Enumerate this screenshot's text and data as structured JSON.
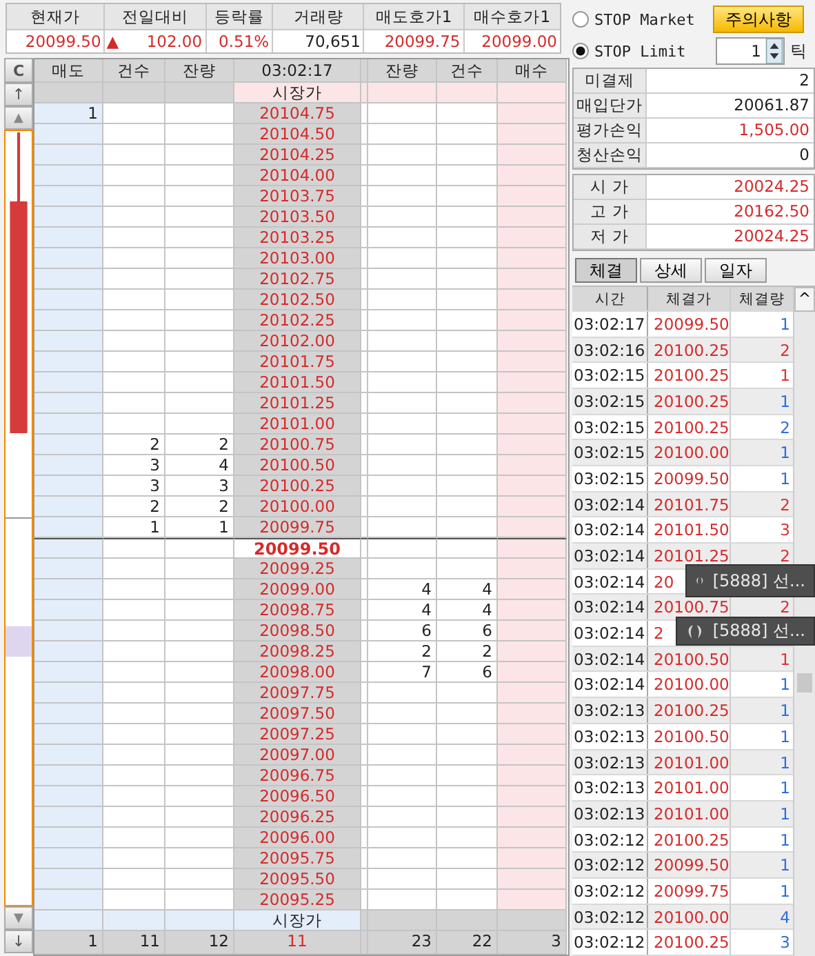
{
  "quotes": [
    {
      "label": "현재가",
      "value": "20099.50",
      "kind": "price"
    },
    {
      "label": "전일대비",
      "arrow": "▲",
      "value": "102.00",
      "kind": "change"
    },
    {
      "label": "등락률",
      "value": "0.51%",
      "kind": "price"
    },
    {
      "label": "거래량",
      "value": "70,651",
      "kind": "volume"
    },
    {
      "label": "매도호가1",
      "value": "20099.75",
      "kind": "price"
    },
    {
      "label": "매수호가1",
      "value": "20099.00",
      "kind": "price"
    }
  ],
  "ladder": {
    "side_buttons": [
      "C",
      "↑",
      "▲",
      "▼",
      "↓"
    ],
    "columns": [
      "매도",
      "건수",
      "잔량",
      "03:02:17",
      "잔량",
      "건수",
      "매수"
    ],
    "market_top": "시장가",
    "market_bottom": "시장가",
    "rows": [
      {
        "price": "20104.75",
        "current": false,
        "ask": "1"
      },
      {
        "price": "20104.50",
        "current": false
      },
      {
        "price": "20104.25",
        "current": false
      },
      {
        "price": "20104.00",
        "current": false
      },
      {
        "price": "20103.75",
        "current": false
      },
      {
        "price": "20103.50",
        "current": false
      },
      {
        "price": "20103.25",
        "current": false
      },
      {
        "price": "20103.00",
        "current": false
      },
      {
        "price": "20102.75",
        "current": false
      },
      {
        "price": "20102.50",
        "current": false
      },
      {
        "price": "20102.25",
        "current": false
      },
      {
        "price": "20102.00",
        "current": false
      },
      {
        "price": "20101.75",
        "current": false
      },
      {
        "price": "20101.50",
        "current": false
      },
      {
        "price": "20101.25",
        "current": false
      },
      {
        "price": "20101.00",
        "current": false
      },
      {
        "price": "20100.75",
        "current": false,
        "ask_count": "2",
        "ask_qty": "2"
      },
      {
        "price": "20100.50",
        "current": false,
        "ask_count": "3",
        "ask_qty": "4"
      },
      {
        "price": "20100.25",
        "current": false,
        "ask_count": "3",
        "ask_qty": "3"
      },
      {
        "price": "20100.00",
        "current": false,
        "ask_count": "2",
        "ask_qty": "2"
      },
      {
        "price": "20099.75",
        "current": false,
        "ask_count": "1",
        "ask_qty": "1"
      },
      {
        "price": "20099.50",
        "current": true
      },
      {
        "price": "20099.25",
        "current": false
      },
      {
        "price": "20099.00",
        "current": false,
        "bid_qty": "4",
        "bid_count": "4"
      },
      {
        "price": "20098.75",
        "current": false,
        "bid_qty": "4",
        "bid_count": "4"
      },
      {
        "price": "20098.50",
        "current": false,
        "bid_qty": "6",
        "bid_count": "6"
      },
      {
        "price": "20098.25",
        "current": false,
        "bid_qty": "2",
        "bid_count": "2"
      },
      {
        "price": "20098.00",
        "current": false,
        "bid_qty": "7",
        "bid_count": "6"
      },
      {
        "price": "20097.75",
        "current": false
      },
      {
        "price": "20097.50",
        "current": false
      },
      {
        "price": "20097.25",
        "current": false
      },
      {
        "price": "20097.00",
        "current": false
      },
      {
        "price": "20096.75",
        "current": false
      },
      {
        "price": "20096.50",
        "current": false
      },
      {
        "price": "20096.25",
        "current": false
      },
      {
        "price": "20096.00",
        "current": false
      },
      {
        "price": "20095.75",
        "current": false
      },
      {
        "price": "20095.50",
        "current": false
      },
      {
        "price": "20095.25",
        "current": false
      }
    ],
    "totals": [
      "1",
      "11",
      "12",
      "11",
      "23",
      "22",
      "3"
    ]
  },
  "stop_options": [
    {
      "label": "STOP Market",
      "selected": false
    },
    {
      "label": "STOP Limit",
      "selected": true
    }
  ],
  "notice_button": "주의사항",
  "tick_input": {
    "value": "1",
    "unit": "틱"
  },
  "position": [
    {
      "label": "미결제",
      "value": "2",
      "kind": "plain"
    },
    {
      "label": "매입단가",
      "value": "20061.87",
      "kind": "plain"
    },
    {
      "label": "평가손익",
      "value": "1,505.00",
      "kind": "profit"
    },
    {
      "label": "청산손익",
      "value": "0",
      "kind": "plain"
    }
  ],
  "day_prices": [
    {
      "label": "시 가",
      "value": "20024.25"
    },
    {
      "label": "고 가",
      "value": "20162.50"
    },
    {
      "label": "저 가",
      "value": "20024.25"
    }
  ],
  "tabs": [
    {
      "label": "체결",
      "selected": true
    },
    {
      "label": "상세",
      "selected": false
    },
    {
      "label": "일자",
      "selected": false
    }
  ],
  "trades": {
    "columns": [
      "시간",
      "체결가",
      "체결량"
    ],
    "scroll_up": "^",
    "rows": [
      {
        "time": "03:02:17",
        "price": "20099.50",
        "qty": "1",
        "color": "#2a6fdb"
      },
      {
        "time": "03:02:16",
        "price": "20100.25",
        "qty": "2",
        "color": "#e03030"
      },
      {
        "time": "03:02:15",
        "price": "20100.25",
        "qty": "1",
        "color": "#e03030"
      },
      {
        "time": "03:02:15",
        "price": "20100.25",
        "qty": "1",
        "color": "#2a6fdb"
      },
      {
        "time": "03:02:15",
        "price": "20100.25",
        "qty": "2",
        "color": "#2a6fdb"
      },
      {
        "time": "03:02:15",
        "price": "20100.00",
        "qty": "1",
        "color": "#2a6fdb"
      },
      {
        "time": "03:02:15",
        "price": "20099.50",
        "qty": "1",
        "color": "#2a6fdb"
      },
      {
        "time": "03:02:14",
        "price": "20101.75",
        "qty": "2",
        "color": "#e03030"
      },
      {
        "time": "03:02:14",
        "price": "20101.50",
        "qty": "3",
        "color": "#e03030"
      },
      {
        "time": "03:02:14",
        "price": "20101.25",
        "qty": "2",
        "color": "#e03030"
      },
      {
        "time": "03:02:14",
        "price": "20"
      },
      {
        "time": "03:02:14",
        "price": "20100.75",
        "qty": "2",
        "color": "#e03030"
      },
      {
        "time": "03:02:14",
        "price": "2"
      },
      {
        "time": "03:02:14",
        "price": "20100.50",
        "qty": "1",
        "color": "#e03030"
      },
      {
        "time": "03:02:14",
        "price": "20100.00",
        "qty": "1",
        "color": "#2a6fdb"
      },
      {
        "time": "03:02:13",
        "price": "20100.25",
        "qty": "1",
        "color": "#2a6fdb"
      },
      {
        "time": "03:02:13",
        "price": "20100.50",
        "qty": "1",
        "color": "#2a6fdb"
      },
      {
        "time": "03:02:13",
        "price": "20101.00",
        "qty": "1",
        "color": "#2a6fdb"
      },
      {
        "time": "03:02:13",
        "price": "20101.00",
        "qty": "1",
        "color": "#2a6fdb"
      },
      {
        "time": "03:02:13",
        "price": "20101.00",
        "qty": "1",
        "color": "#2a6fdb"
      },
      {
        "time": "03:02:12",
        "price": "20100.25",
        "qty": "1",
        "color": "#2a6fdb"
      },
      {
        "time": "03:02:12",
        "price": "20099.50",
        "qty": "1",
        "color": "#2a6fdb"
      },
      {
        "time": "03:02:12",
        "price": "20099.75",
        "qty": "1",
        "color": "#2a6fdb"
      },
      {
        "time": "03:02:12",
        "price": "20100.00",
        "qty": "4",
        "color": "#2a6fdb"
      },
      {
        "time": "03:02:12",
        "price": "20100.25",
        "qty": "3",
        "color": "#2a6fdb"
      }
    ]
  },
  "toasts": [
    {
      "text": "[5888] 선..."
    },
    {
      "text": "[5888] 선..."
    }
  ]
}
